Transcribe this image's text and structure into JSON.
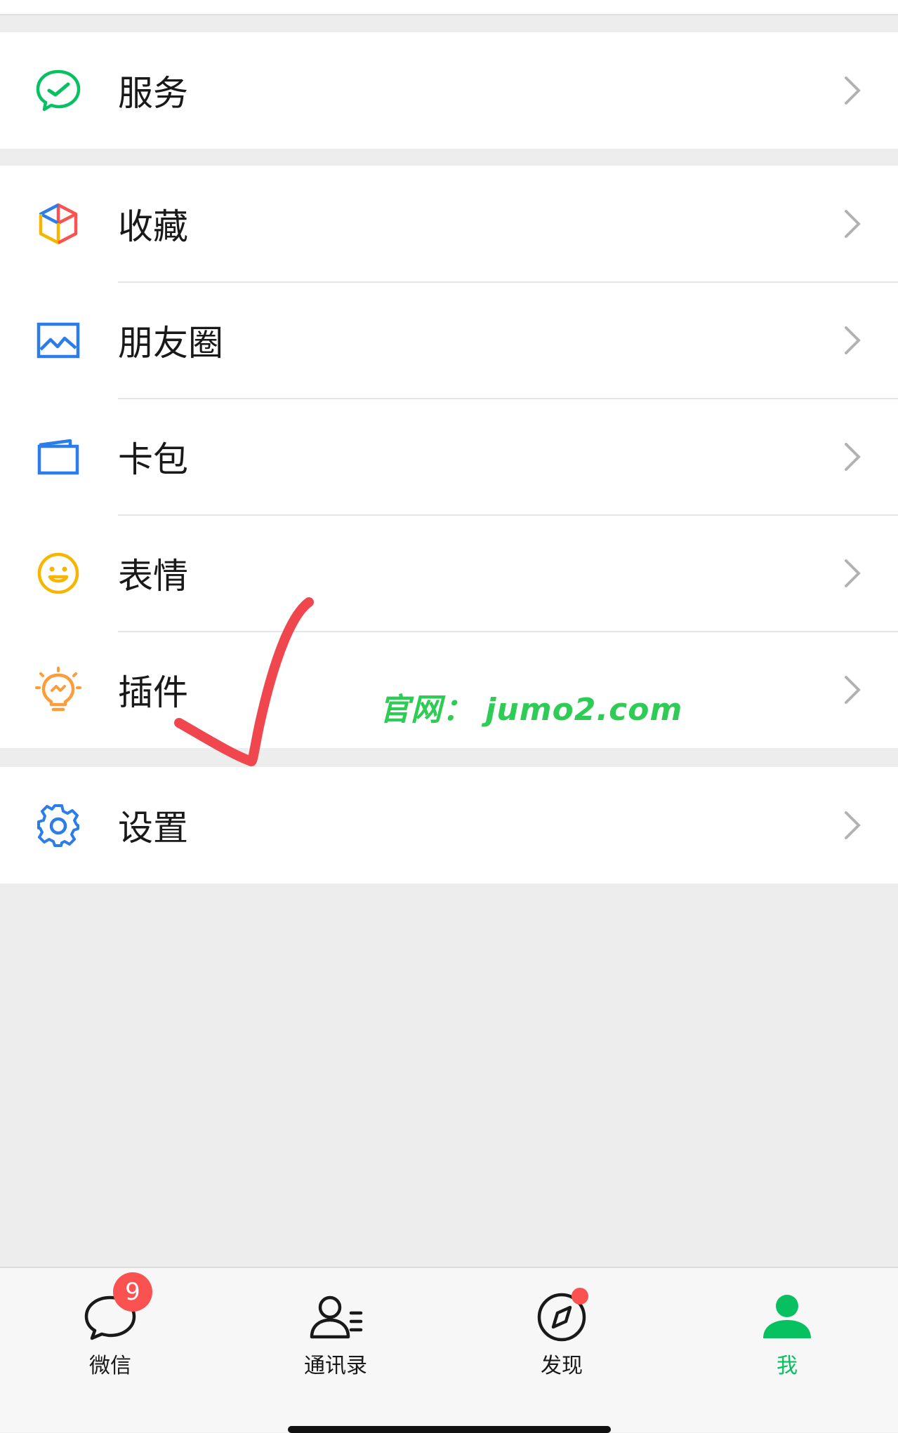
{
  "menu": {
    "services": {
      "label": "服务",
      "icon": "services-icon"
    },
    "favorites": {
      "label": "收藏",
      "icon": "cube-icon"
    },
    "moments": {
      "label": "朋友圈",
      "icon": "picture-icon"
    },
    "cards": {
      "label": "卡包",
      "icon": "wallet-icon"
    },
    "stickers": {
      "label": "表情",
      "icon": "smiley-icon"
    },
    "plugins": {
      "label": "插件",
      "icon": "lightbulb-icon"
    },
    "settings": {
      "label": "设置",
      "icon": "gear-icon"
    }
  },
  "watermark": "官网： jumo2.com",
  "tabbar": {
    "chats": {
      "label": "微信",
      "badge": "9"
    },
    "contacts": {
      "label": "通讯录"
    },
    "discover": {
      "label": "发现"
    },
    "me": {
      "label": "我"
    }
  },
  "colors": {
    "accent": "#07c160",
    "badge": "#fa5151",
    "annotation": "#f0474f"
  }
}
